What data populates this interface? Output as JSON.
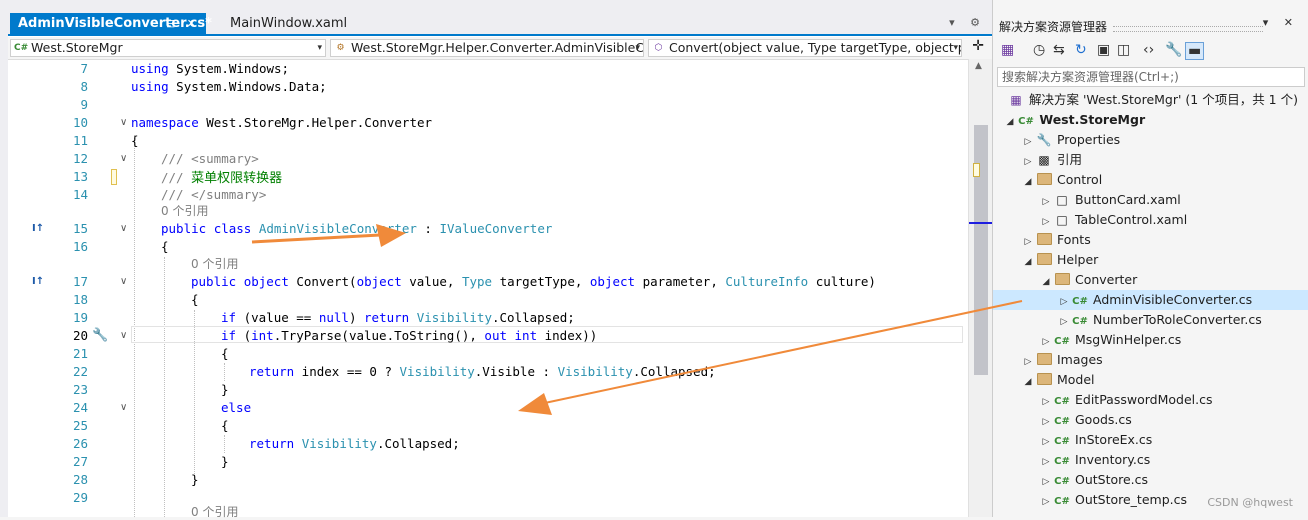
{
  "tabs": [
    {
      "label": "AdminVisibleConverter.cs*",
      "active": true,
      "buttons": "⊟ ✕"
    },
    {
      "label": "MainWindow.xaml",
      "active": false
    }
  ],
  "tab_overflow": "▾ ⚙",
  "nav": {
    "project": "West.StoreMgr",
    "class": "West.StoreMgr.Helper.Converter.AdminVisibleCo",
    "member": "Convert(object value, Type targetType, object pa"
  },
  "code": {
    "line_numbers": [
      "7",
      "8",
      "9",
      "10",
      "11",
      "12",
      "13",
      "14",
      "15",
      "16",
      "17",
      "18",
      "19",
      "20",
      "21",
      "22",
      "23",
      "24",
      "25",
      "26",
      "27",
      "28",
      "29"
    ],
    "l7": [
      "using",
      " System.Windows;"
    ],
    "l8": [
      "using",
      " System.Windows.Data;"
    ],
    "l10": [
      "namespace",
      " West.StoreMgr.Helper.Converter"
    ],
    "l11": "{",
    "l12": "/// <summary>",
    "l13_prefix": "/// ",
    "l13_text": "菜单权限转换器",
    "l14": "/// </summary>",
    "ref1": "0 个引用",
    "l15": [
      "public",
      " ",
      "class",
      " ",
      "AdminVisibleConverter",
      " : ",
      "IValueConverter"
    ],
    "l16": "{",
    "ref2": "0 个引用",
    "l17": [
      "public",
      " ",
      "object",
      " Convert(",
      "object",
      " value, ",
      "Type",
      " targetType, ",
      "object",
      " parameter, ",
      "CultureInfo",
      " culture)"
    ],
    "l18": "{",
    "l19": [
      "if",
      " (value == ",
      "null",
      ") ",
      "return",
      " ",
      "Visibility",
      ".Collapsed;"
    ],
    "l20": [
      "if",
      " (",
      "int",
      ".TryParse(value.ToString(), ",
      "out",
      " ",
      "int",
      " index))"
    ],
    "l21": "{",
    "l22": [
      "return",
      " index == 0 ? ",
      "Visibility",
      ".Visible : ",
      "Visibility",
      ".Collapsed;"
    ],
    "l23": "}",
    "l24": "else",
    "l25": "{",
    "l26": [
      "return",
      " ",
      "Visibility",
      ".Collapsed;"
    ],
    "l27": "}",
    "l28": "}",
    "ref3": "0 个引用"
  },
  "explorer": {
    "title": "解决方案资源管理器",
    "title_buttons": "▾ ✕",
    "search_placeholder": "搜索解决方案资源管理器(Ctrl+;)",
    "solution": "解决方案 'West.StoreMgr' (1 个项目，共 1 个)",
    "project": "West.StoreMgr",
    "items": {
      "properties": "Properties",
      "references": "引用",
      "control": "Control",
      "buttoncard": "ButtonCard.xaml",
      "tablecontrol": "TableControl.xaml",
      "fonts": "Fonts",
      "helper": "Helper",
      "converter": "Converter",
      "adminvisible": "AdminVisibleConverter.cs",
      "numbertorole": "NumberToRoleConverter.cs",
      "msgwinhelper": "MsgWinHelper.cs",
      "images": "Images",
      "model": "Model",
      "editpassword": "EditPasswordModel.cs",
      "goods": "Goods.cs",
      "instoreex": "InStoreEx.cs",
      "inventory": "Inventory.cs",
      "outstore": "OutStore.cs",
      "outstoretemp": "OutStore_temp.cs"
    },
    "cs_badge": "C#"
  },
  "watermark": "CSDN @hqwest",
  "colors": {
    "accent": "#007acc",
    "arrow": "#f08a3a",
    "keyword": "#0000ff",
    "type": "#2b91af",
    "comment": "#008000"
  }
}
